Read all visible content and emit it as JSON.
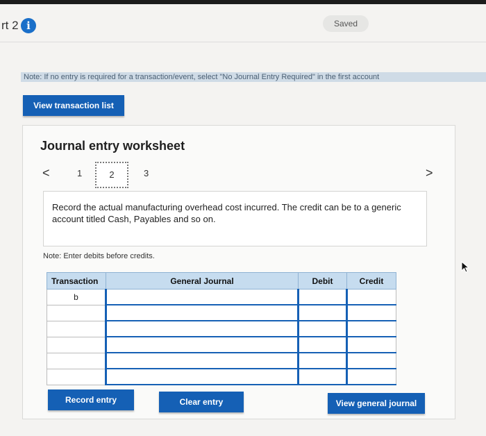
{
  "header": {
    "part_label": "rt 2",
    "info_icon": "i",
    "saved_label": "Saved"
  },
  "note_strip": "Note: If no entry is required for a transaction/event, select \"No Journal Entry Required\" in the first account",
  "buttons": {
    "view_transactions": "View transaction list",
    "record_entry": "Record entry",
    "clear_entry": "Clear entry",
    "view_general_journal": "View general journal"
  },
  "worksheet": {
    "title": "Journal entry worksheet",
    "nav": {
      "prev": "<",
      "next": ">",
      "pages": [
        "1",
        "2",
        "3"
      ],
      "current": "2"
    },
    "instruction": "Record the actual manufacturing overhead cost incurred. The credit can be to a generic account titled Cash, Payables and so on.",
    "debits_note": "Note: Enter debits before credits.",
    "table": {
      "headers": {
        "transaction": "Transaction",
        "general_journal": "General Journal",
        "debit": "Debit",
        "credit": "Credit"
      },
      "rows": [
        {
          "transaction": "b",
          "account": "",
          "debit": "",
          "credit": ""
        },
        {
          "transaction": "",
          "account": "",
          "debit": "",
          "credit": ""
        },
        {
          "transaction": "",
          "account": "",
          "debit": "",
          "credit": ""
        },
        {
          "transaction": "",
          "account": "",
          "debit": "",
          "credit": ""
        },
        {
          "transaction": "",
          "account": "",
          "debit": "",
          "credit": ""
        },
        {
          "transaction": "",
          "account": "",
          "debit": "",
          "credit": ""
        }
      ]
    }
  },
  "colors": {
    "accent": "#1560b5",
    "header_bg": "#c6dcef",
    "info": "#1a6fc9"
  }
}
